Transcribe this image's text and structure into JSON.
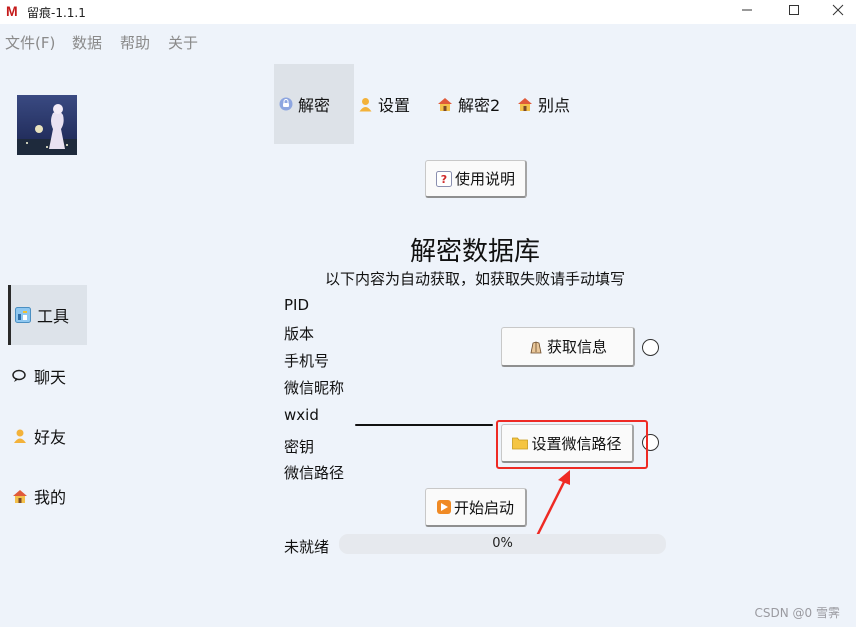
{
  "window": {
    "title": "留痕-1.1.1",
    "logo_letter": "M"
  },
  "menu": [
    "文件(F)",
    "数据",
    "帮助",
    "关于"
  ],
  "sidebar": {
    "items": [
      {
        "label": "工具",
        "icon": "tools-icon",
        "active": true
      },
      {
        "label": "聊天",
        "icon": "chat-icon",
        "active": false
      },
      {
        "label": "好友",
        "icon": "user-icon",
        "active": false
      },
      {
        "label": "我的",
        "icon": "home-icon",
        "active": false
      }
    ]
  },
  "tabs": [
    {
      "label": "解密",
      "icon": "decrypt-icon",
      "active": true
    },
    {
      "label": "设置",
      "icon": "user-icon",
      "active": false
    },
    {
      "label": "解密2",
      "icon": "home-icon",
      "active": false
    },
    {
      "label": "别点",
      "icon": "home-icon",
      "active": false
    }
  ],
  "main": {
    "help_button": "使用说明",
    "heading": "解密数据库",
    "subheading": "以下内容为自动获取，如获取失败请手动填写",
    "fields": [
      "PID",
      "版本",
      "手机号",
      "微信昵称",
      "wxid",
      "密钥",
      "微信路径"
    ],
    "get_info_button": "获取信息",
    "set_path_button": "设置微信路径",
    "start_button": "开始启动",
    "status_label": "未就绪",
    "progress": {
      "value": 0,
      "text": "0%"
    }
  },
  "watermark": "CSDN @0 雪霁",
  "colors": {
    "highlight": "#ee2a24",
    "background": "#eef3fa",
    "tab_active": "#dde2e8"
  }
}
